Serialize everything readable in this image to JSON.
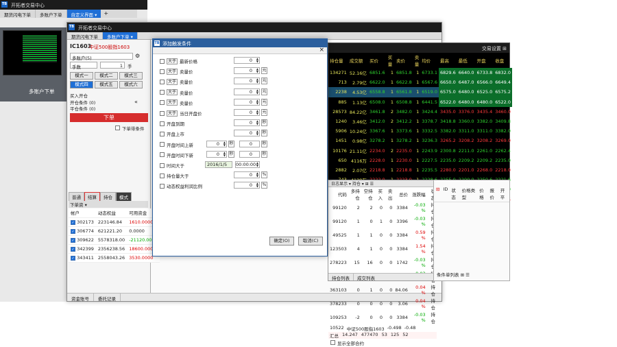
{
  "back_window": {
    "title": "开拓者交易中心",
    "tabs": [
      "期货闪电下单",
      "多账户下单",
      "自定义界面 ▾"
    ],
    "new_tab": "+",
    "panel_label": "多账户下单"
  },
  "mid_window": {
    "title": "开拓者交易中心",
    "tabs": [
      "期货闪电下单",
      "多账户下单 ▾"
    ],
    "toolbar_right": "交易设置 ⊞",
    "contract_code": "IC1603",
    "contract_name": "中证500股指1603",
    "account_mode": "多账户(5)",
    "qty_label": "手数",
    "qty_value": "1",
    "qty_unit": "手",
    "mode_buttons": [
      [
        "模式一",
        "模式二",
        "模式三"
      ],
      [
        "模式四",
        "模式五",
        "模式六"
      ]
    ],
    "buy_open": "买入开仓",
    "open_cond": "开仓条件 (0)",
    "close_cond": "平仓条件 (0)",
    "order_button": "下单",
    "cond_order_label": "下单带条件",
    "bottom_tabs": [
      "普通",
      "结算",
      "持仓",
      "模式"
    ],
    "sub_tab": "下单资 ▾",
    "accounts_header": [
      "帐户",
      "动态权益",
      "可用资金"
    ],
    "accounts": [
      {
        "id": "302173",
        "equity": "223146.84",
        "avail": "1610.0000"
      },
      {
        "id": "306774",
        "equity": "621221.20",
        "avail": "0.0000"
      },
      {
        "id": "309622",
        "equity": "5578318.00",
        "avail": "-21120.0000"
      },
      {
        "id": "342399",
        "equity": "2356238.56",
        "avail": "18600.0000"
      },
      {
        "id": "343411",
        "equity": "2558043.26",
        "avail": "3530.0000"
      }
    ],
    "status_tabs": [
      "资金账号",
      "委托记录"
    ]
  },
  "dialog": {
    "title": "添加触发条件",
    "close": "×",
    "conditions": [
      {
        "label": "最新价格",
        "op": "大于",
        "val": "0",
        "unit": ""
      },
      {
        "label": "卖量价",
        "op": "大于",
        "val": "0",
        "unit": "元"
      },
      {
        "label": "卖量价",
        "op": "大于",
        "val": "0",
        "unit": "元"
      },
      {
        "label": "卖量价",
        "op": "大于",
        "val": "0",
        "unit": "元"
      },
      {
        "label": "卖量价",
        "op": "大于",
        "val": "0",
        "unit": "元"
      },
      {
        "label": "当日开盘价",
        "op": "大于",
        "val": "0",
        "unit": "元"
      },
      {
        "label": "开盘到期",
        "op": "",
        "val": "0",
        "unit": "秒"
      },
      {
        "label": "开盘上市",
        "op": "",
        "val": "0",
        "unit": "秒"
      },
      {
        "label": "开盘时间上新",
        "op": "",
        "val": "0",
        "unit": "秒"
      },
      {
        "label": "开盘时间下新",
        "op": "",
        "val": "0",
        "unit": "秒"
      },
      {
        "label": "时间大于",
        "op": "",
        "val": "00:00:00",
        "unit": ""
      },
      {
        "label": "持仓量大于",
        "op": "",
        "val": "0",
        "unit": "%"
      },
      {
        "label": "动态权益利润比例",
        "op": "",
        "val": "0",
        "unit": "%"
      }
    ],
    "date_value": "2016/1/5",
    "second_unit": "秒",
    "ok": "确定(O)",
    "cancel": "取消(C)"
  },
  "quote_window": {
    "title": "交易设置 ⊞",
    "headers": [
      "持仓量",
      "成交额",
      "买价",
      "买量",
      "卖价",
      "卖量",
      "均价",
      "最高",
      "最低",
      "开盘",
      "收盘"
    ],
    "rows": [
      [
        "134271",
        "52.16亿",
        "6851.6",
        "1",
        "6851.8",
        "1",
        "6733.1",
        "6829.6",
        "6640.0",
        "6733.8",
        "6832.0"
      ],
      [
        "713",
        "2.79亿",
        "6622.0",
        "1",
        "6622.8",
        "1",
        "6567.6",
        "6650.0",
        "6487.0",
        "6566.0",
        "6649.4"
      ],
      [
        "2238",
        "4.53亿",
        "6558.8",
        "1",
        "6561.8",
        "1",
        "6519.0",
        "6575.0",
        "6480.0",
        "6525.0",
        "6575.2"
      ],
      [
        "885",
        "1.13亿",
        "6508.0",
        "1",
        "6508.8",
        "1",
        "6441.5",
        "6522.0",
        "6480.0",
        "6480.0",
        "6522.0"
      ],
      [
        "28573",
        "84.22亿",
        "3461.8",
        "2",
        "3482.0",
        "1",
        "3424.4",
        "3435.0",
        "3376.0",
        "3435.4",
        "3460.0"
      ],
      [
        "1240",
        "3.46亿",
        "3412.0",
        "2",
        "3412.2",
        "1",
        "3378.7",
        "3418.8",
        "3360.0",
        "3382.0",
        "3409.8"
      ],
      [
        "5906",
        "10.24亿",
        "3367.6",
        "1",
        "3373.6",
        "1",
        "3332.5",
        "3382.0",
        "3311.0",
        "3311.0",
        "3382.0"
      ],
      [
        "1451",
        "0.98亿",
        "3278.2",
        "1",
        "3278.2",
        "1",
        "3236.3",
        "3265.2",
        "3208.2",
        "3208.2",
        "3269.0"
      ],
      [
        "10176",
        "21.11亿",
        "2234.0",
        "2",
        "2235.0",
        "1",
        "2243.9",
        "2300.8",
        "2211.0",
        "2261.0",
        "2262.4"
      ],
      [
        "650",
        "4116万",
        "2228.0",
        "1",
        "2230.0",
        "1",
        "2227.5",
        "2235.0",
        "2209.2",
        "2209.2",
        "2235.0"
      ],
      [
        "2882",
        "2.07亿",
        "2218.8",
        "1",
        "2218.8",
        "1",
        "2235.5",
        "2280.0",
        "2201.0",
        "2268.0",
        "2218.0"
      ],
      [
        "743",
        "4129万",
        "2222.0",
        "1",
        "2223.0",
        "1",
        "2228.6",
        "2255.0",
        "2200.0",
        "2250.6",
        "2221.6"
      ],
      [
        "27891",
        "61.54亿",
        "99.780",
        "21",
        "99.785",
        "1",
        "99.734",
        "99.790",
        "99.685",
        "99.690",
        "99.780"
      ],
      [
        "4344",
        "2.53亿",
        "99.210",
        "3",
        "99.220",
        "1",
        "99.184",
        "99.220",
        "99.150",
        "99.160",
        "99.215"
      ]
    ]
  },
  "positions": {
    "tabs": "日志显示 ▾ 持仓 ▾ ⊞ ☰",
    "headers": [
      "代码",
      "多持仓",
      "空持仓",
      "买入",
      "卖出",
      "总价",
      "涨跌幅",
      "状态"
    ],
    "rows": [
      [
        "99120",
        "2",
        "2",
        "0",
        "0",
        "3384",
        "-0.03 %",
        "持仓"
      ],
      [
        "99120",
        "1",
        "0",
        "1",
        "0",
        "3396",
        "-0.03 %",
        "持仓"
      ],
      [
        "49525",
        "1",
        "1",
        "0",
        "0",
        "3384",
        "0.59 %",
        "持仓"
      ],
      [
        "123503",
        "4",
        "1",
        "0",
        "0",
        "3384",
        "1.54 %",
        "持仓"
      ],
      [
        "278223",
        "15",
        "16",
        "0",
        "0",
        "1742",
        "-0.03 %",
        "持仓"
      ],
      [
        "363103",
        "0",
        "1",
        "0",
        "0",
        "3.06",
        "-0.03 %",
        "持仓"
      ],
      [
        "363103",
        "0",
        "1",
        "0",
        "0",
        "84.06",
        "0.04 %",
        "持仓"
      ],
      [
        "378233",
        "0",
        "0",
        "0",
        "0",
        "3.06",
        "0.04 %",
        "持仓"
      ],
      [
        "109253",
        "-2",
        "0",
        "0",
        "0",
        "3384",
        "-0.03 %",
        "持仓"
      ]
    ],
    "summary_code": "10522",
    "summary_label": "中证500股指1603",
    "summary_vals": [
      "-0.498",
      "-0.48"
    ],
    "total_label": "汇总",
    "total_vals": [
      "14.247",
      "477470",
      "53",
      "125",
      "52"
    ],
    "footer_tabs": [
      "持仓列表",
      "成交列表"
    ],
    "footer_check": "显示全部合约"
  },
  "right_panel": {
    "headers": [
      "ID",
      "状态",
      "价格类型",
      "价格",
      "报价",
      "开平"
    ],
    "footer": "条件单列表 ⊞ ☰"
  }
}
